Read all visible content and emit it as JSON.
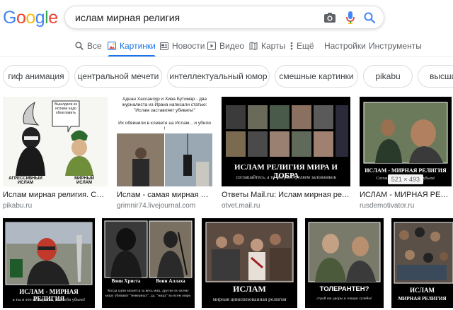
{
  "logo": {
    "letters": [
      "G",
      "o",
      "o",
      "g",
      "l",
      "e"
    ],
    "colors": [
      "#4285f4",
      "#ea4335",
      "#fbbc05",
      "#4285f4",
      "#34a853",
      "#ea4335"
    ]
  },
  "search": {
    "query": "ислам мирная религия",
    "icons": [
      "camera-icon",
      "microphone-icon",
      "search-icon"
    ]
  },
  "tabs": [
    {
      "label": "Все",
      "icon": "search-icon",
      "active": false
    },
    {
      "label": "Картинки",
      "icon": "image-icon",
      "active": true
    },
    {
      "label": "Новости",
      "icon": "news-icon",
      "active": false
    },
    {
      "label": "Видео",
      "icon": "video-icon",
      "active": false
    },
    {
      "label": "Карты",
      "icon": "map-icon",
      "active": false
    },
    {
      "label": "Ещё",
      "icon": "more-icon",
      "active": false
    },
    {
      "label": "Настройки",
      "active": false
    },
    {
      "label": "Инструменты",
      "active": false
    }
  ],
  "accent_color": "#1a73e8",
  "chips": [
    "гиф анимация",
    "центральной мечети",
    "интеллектуальный юмор",
    "смешные картинки",
    "pikabu",
    "высший р"
  ],
  "results_row1": [
    {
      "caption": "Ислам мирная религия. Случай в ...",
      "source": "pikabu.ru",
      "image_text": [
        "Вышлдали из ислама надо обезглавить",
        "АГРЕССИВНЫЙ ИСЛАМ",
        "МИРНЫЙ ИСЛАМ"
      ]
    },
    {
      "caption": "Ислам - самая мирная религия ...",
      "source": "grimnir74.livejournal.com",
      "image_text": [
        "Аднан Хассанпур и Хива Бутимар - два журналиста из Ирана написали статью: \"Ислам заставляет убивать!\"",
        "Их обвинили в клевете на Ислам... и убили !"
      ]
    },
    {
      "caption": "Ответы Mail.ru: Ислам мирная религия?",
      "source": "otvet.mail.ru",
      "image_text": [
        "ИСЛАМ РЕЛИГИЯ МИРА И ДОБРА",
        "соглашайтесь, а то мы расстреляем заложников"
      ]
    },
    {
      "caption": "ИСЛАМ - МИРНАЯ РЕЛИГИЯ ...",
      "source": "rusdemotivator.ru",
      "image_text": [
        "ИСЛАМ - МИРНАЯ РЕЛИГИЯ",
        "Соглашайся, или мы тебя убьем!"
      ],
      "dimensions": "521 × 493"
    }
  ],
  "results_row2": [
    {
      "image_text": [
        "ИСЛАМ - МИРНАЯ РЕЛИГИЯ",
        "а ты в это не веришь, мы тебя убьем!"
      ]
    },
    {
      "image_text": [
        "Воин Христа",
        "Воин Аллаха",
        "Когда одни молятся за весь мир, другие по всему миру убивают \"неверных\", да, \"мира\" во всем мире."
      ]
    },
    {
      "image_text": [
        "ИСЛАМ",
        "мирная цивилизованная религия"
      ]
    },
    {
      "image_text": [
        "ТОЛЕРАНТЕН?",
        "строй им дворы и говори сулейм!"
      ]
    },
    {
      "image_text": [
        "ИСЛАМ",
        "МИРНАЯ РЕЛИГИЯ"
      ]
    }
  ]
}
